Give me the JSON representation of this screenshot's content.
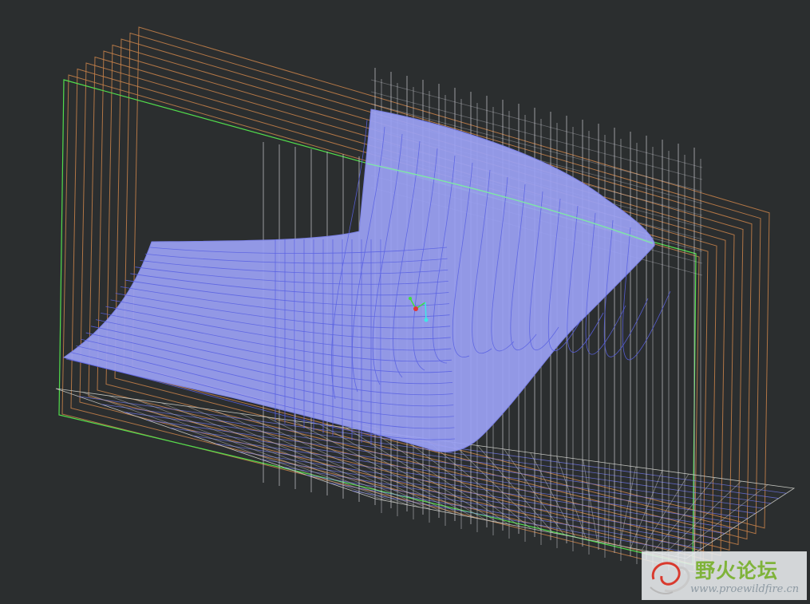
{
  "viewport": {
    "background": "#2b2e2f",
    "colors": {
      "datum_plane": "#c9824a",
      "datum_plane_highlight": "#52dd4c",
      "grid_line": "#c2c3bd",
      "surface_fill": "#9aa0f3",
      "surface_isoline": "#5a62e2",
      "triad_x": "#3ee03e",
      "triad_y": "#e23434",
      "triad_z": "#3ee7e7"
    }
  },
  "watermark": {
    "title": "野火论坛",
    "url": "www.proewildfire.cn",
    "logo_icon": "wildfire-swirl-logo"
  }
}
